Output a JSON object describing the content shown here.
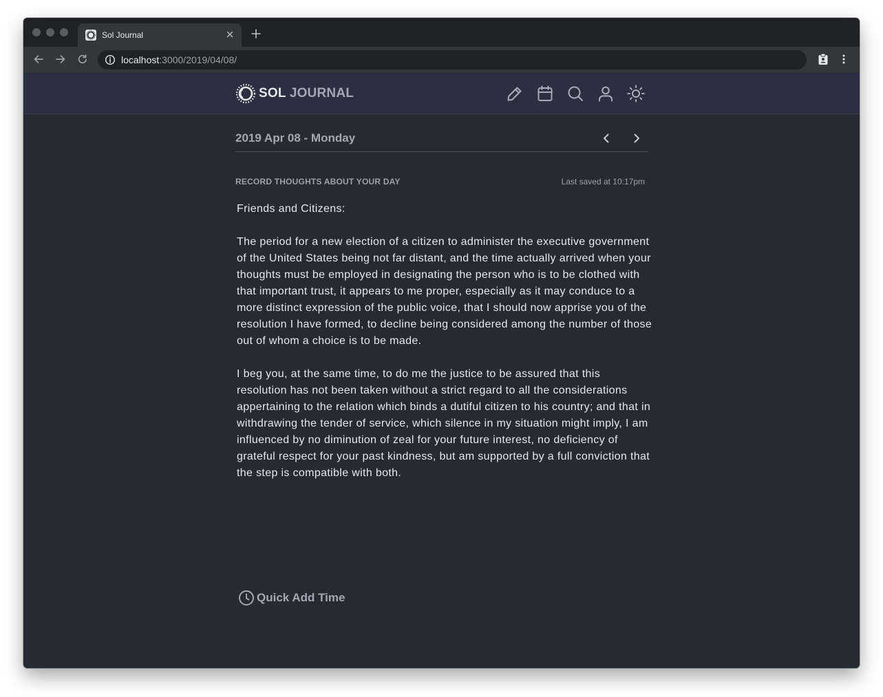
{
  "browser": {
    "tab_title": "Sol Journal",
    "url_host": "localhost",
    "url_path": ":3000/2019/04/08/"
  },
  "app": {
    "logo_sol": "SOL",
    "logo_journal": "JOURNAL",
    "header_icons": [
      "pencil-icon",
      "calendar-icon",
      "search-icon",
      "user-icon",
      "sun-icon"
    ],
    "date_title": "2019 Apr 08 - Monday",
    "section_label": "RECORD THOUGHTS ABOUT YOUR DAY",
    "last_saved": "Last saved at 10:17pm",
    "entry": {
      "greeting": "Friends and Citizens:",
      "paragraph_1": "The period for a new election of a citizen to administer the executive government of the United States being not far distant, and the time actually arrived when your thoughts must be employed in designating the person who is to be clothed with that important trust, it appears to me proper, especially as it may conduce to a more distinct expression of the public voice, that I should now apprise you of the resolution I have formed, to decline being considered among the number of those out of whom a choice is to be made.",
      "paragraph_2": "I beg you, at the same time, to do me the justice to be assured that this resolution has not been taken without a strict regard to all the considerations appertaining to the relation which binds a dutiful citizen to his country; and that in withdrawing the tender of service, which silence in my situation might imply, I am influenced by no diminution of zeal for your future interest, no deficiency of grateful respect for your past kindness, but am supported by a full conviction that the step is compatible with both."
    },
    "quick_add_label": "Quick Add Time"
  },
  "colors": {
    "background": "#262a33",
    "header": "#2b3040",
    "text": "#e6e8ec",
    "muted": "#a3a8b3"
  }
}
